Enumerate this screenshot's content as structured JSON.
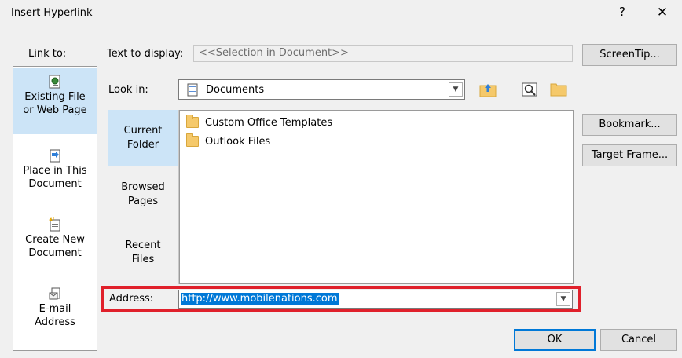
{
  "dialog": {
    "title": "Insert Hyperlink",
    "help": "?",
    "close": "✕"
  },
  "link_to": {
    "label": "Link to:",
    "items": [
      {
        "line1": "Existing File",
        "line2": "or Web Page",
        "selected": true,
        "icon": "existing-file-icon"
      },
      {
        "line1": "Place in This",
        "line2": "Document",
        "selected": false,
        "icon": "place-in-document-icon"
      },
      {
        "line1": "Create New",
        "line2": "Document",
        "selected": false,
        "icon": "create-new-document-icon"
      },
      {
        "line1": "E-mail",
        "line2": "Address",
        "selected": false,
        "icon": "email-address-icon"
      }
    ]
  },
  "text_to_display": {
    "label": "Text to display:",
    "value": "<<Selection in Document>>"
  },
  "screentip_button": "ScreenTip...",
  "look_in": {
    "label": "Look in:",
    "value": "Documents"
  },
  "source": {
    "items": [
      {
        "line1": "Current",
        "line2": "Folder",
        "selected": true
      },
      {
        "line1": "Browsed",
        "line2": "Pages",
        "selected": false
      },
      {
        "line1": "Recent",
        "line2": "Files",
        "selected": false
      }
    ]
  },
  "files": [
    {
      "name": "Custom Office Templates",
      "icon": "folder-icon"
    },
    {
      "name": "Outlook Files",
      "icon": "folder-icon"
    }
  ],
  "side_buttons": {
    "bookmark": "Bookmark...",
    "target_frame": "Target Frame..."
  },
  "address": {
    "label": "Address:",
    "value": "http://www.mobilenations.com"
  },
  "ok_button": "OK",
  "cancel_button": "Cancel",
  "colors": {
    "highlight_border": "#e0202b",
    "selection": "#0078d7",
    "selected_tab": "#cce4f7"
  }
}
